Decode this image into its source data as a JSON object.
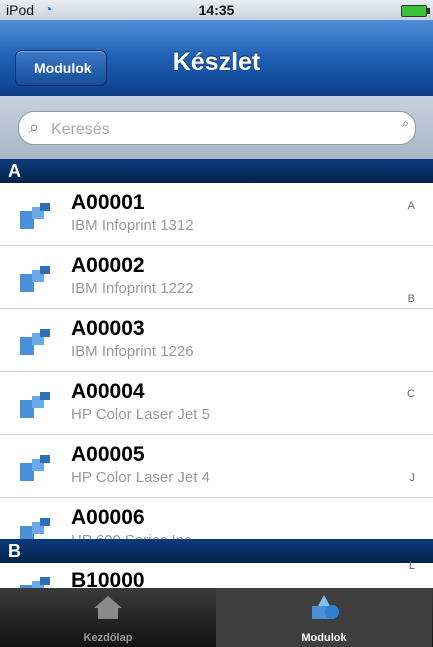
{
  "status": {
    "carrier": "iPod",
    "time": "14:35"
  },
  "nav": {
    "back_label": "Modulok",
    "title": "Készlet"
  },
  "search": {
    "placeholder": "Keresés"
  },
  "sections": [
    {
      "letter": "A"
    },
    {
      "letter": "B"
    }
  ],
  "items": [
    {
      "code": "A00001",
      "name": "IBM Infoprint 1312"
    },
    {
      "code": "A00002",
      "name": "IBM Infoprint 1222"
    },
    {
      "code": "A00003",
      "name": "IBM Infoprint 1226"
    },
    {
      "code": "A00004",
      "name": "HP Color Laser Jet 5"
    },
    {
      "code": "A00005",
      "name": "HP Color Laser Jet 4"
    },
    {
      "code": "A00006",
      "name": "HP 600 Series Inc"
    },
    {
      "code": "B10000",
      "name": ""
    }
  ],
  "index": [
    "A",
    "B",
    "C",
    "J",
    "L"
  ],
  "tabs": [
    {
      "label": "Kezdőlap",
      "icon": "home-icon",
      "active": false
    },
    {
      "label": "Modulok",
      "icon": "modules-icon",
      "active": true
    }
  ],
  "colors": {
    "nav_blue": "#1f5fb4",
    "section_blue": "#0b3b7c",
    "icon_blue": "#4a90d9"
  }
}
